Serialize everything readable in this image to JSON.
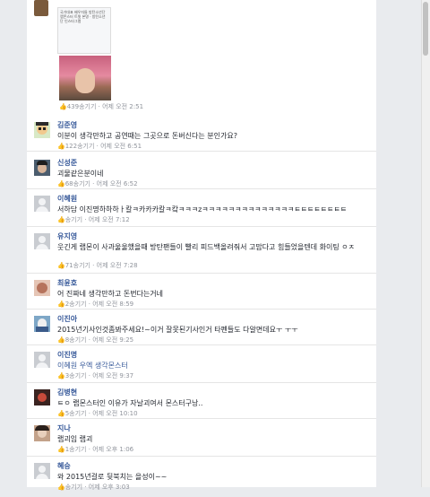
{
  "top_post": {
    "author": "",
    "card_text": "국가대표 배우자들 방탄소년단 랩몬스터 트윗 본명 · 방탄소년단 인스타그램",
    "meta": {
      "likes": "439송기기",
      "time": "어제 오전 2:51"
    }
  },
  "comments": [
    {
      "name": "김준영",
      "text": "이분이 생각만하고 공연때는 그곳으로 돈버신다는 분인가요?",
      "likes": "122송기기",
      "time": "어제 오전 6:51"
    },
    {
      "name": "신성준",
      "text": "괴물같은분이네",
      "likes": "68송기기",
      "time": "어제 오전 6:52"
    },
    {
      "name": "이혜원",
      "text": "서하담 이진명하하하ㅏ칼ㅋ카카카칼ㅋ캌ㅋㅋㅋzㅋㅋㅋㅋㅋㅋㅋㅋㅋㅋㅋㅋㅋㅋㅌㅌㅌㅌㅌㅌㅌㅌ",
      "likes": "송기기",
      "time": "어제 오전 7:12"
    },
    {
      "name": "유지영",
      "text": "웃긴게 랩몬이 사과울울했을때 방탄팬들이 빨리 피드백올려줘서 고맙다고 힘들었을텐데 화이팅 ㅇㅈ",
      "likes": "71송기기",
      "time": "어제 오전 7:28"
    },
    {
      "name": "최윤호",
      "text": "어 진짜네 생각만하고 돈번다는거네",
      "likes": "2송기기",
      "time": "어제 오전 8:59"
    },
    {
      "name": "이진아",
      "text": "2015년기사인것좀봐주세요!~이거 잘못된기사인거 타펜들도 다알면데요ㅜ ㅜㅜ",
      "likes": "8송기기",
      "time": "어제 오전 9:25"
    },
    {
      "name": "이진명",
      "text": "이혜원 우엑 생각몬스터",
      "likes": "3송기기",
      "time": "어제 오전 9:37"
    },
    {
      "name": "김병현",
      "text": "ㅌㅇ 랩몬스터인 이유가 자날괴여서 몬스터구낭..",
      "likes": "5송기기",
      "time": "어제 오전 10:10"
    },
    {
      "name": "지나",
      "text": "랩괴임 랩괴",
      "likes": "1송기기",
      "time": "어제 오후 1:06"
    },
    {
      "name": "혜승",
      "text": "와 2015년걸로 뒷북치는 을성이~~",
      "likes": "송기기",
      "time": "어제 오후 3:03"
    }
  ],
  "colors": {
    "name": "#365899",
    "meta": "#90949c",
    "like": "#4267b2"
  },
  "avatar_styles": [
    "cartoon",
    "photo",
    "silhouette",
    "silhouette",
    "photo",
    "photo",
    "silhouette",
    "photo",
    "photo",
    "silhouette"
  ]
}
